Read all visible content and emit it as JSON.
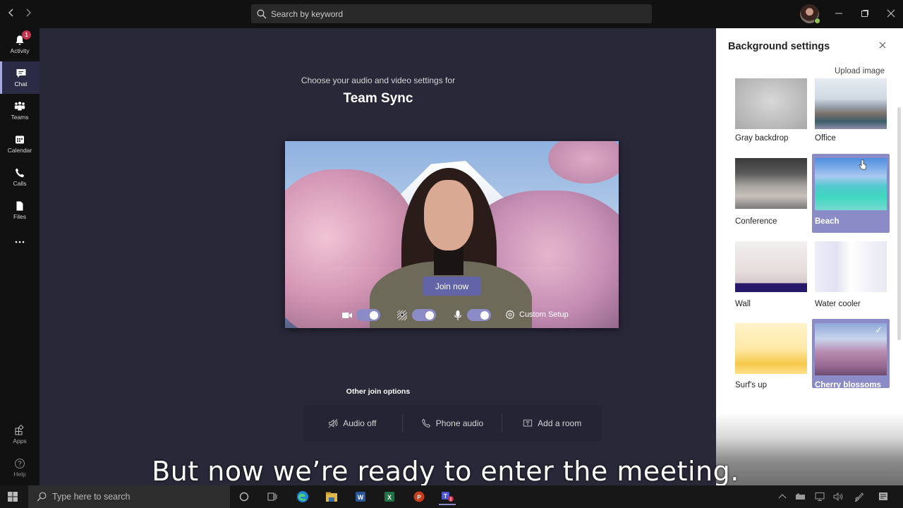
{
  "titlebar": {
    "back_icon": "chevron-left-icon",
    "forward_icon": "chevron-right-icon",
    "search_placeholder": "Search by keyword",
    "window_controls": [
      "minimize",
      "maximize",
      "close"
    ],
    "user_presence": "available",
    "presence_color": "#92c353"
  },
  "rail": {
    "items": [
      {
        "label": "Activity",
        "icon": "bell-icon",
        "badge": "1",
        "active": false
      },
      {
        "label": "Chat",
        "icon": "chat-icon",
        "active": true
      },
      {
        "label": "Teams",
        "icon": "teams-icon",
        "active": false
      },
      {
        "label": "Calendar",
        "icon": "calendar-icon",
        "active": false
      },
      {
        "label": "Calls",
        "icon": "phone-icon",
        "active": false
      },
      {
        "label": "Files",
        "icon": "file-icon",
        "active": false
      },
      {
        "label": "",
        "icon": "more-icon",
        "active": false
      }
    ],
    "bottom_items": [
      {
        "label": "Apps",
        "icon": "apps-icon"
      },
      {
        "label": "Help",
        "icon": "help-icon"
      }
    ],
    "badge_color": "#c4314b",
    "active_color": "#a6a7dc"
  },
  "prejoin": {
    "prompt": "Choose your audio and video settings for",
    "meeting_title": "Team Sync",
    "join_label": "Join now",
    "video_on": true,
    "blur_on": true,
    "mic_on": true,
    "custom_setup_label": "Custom Setup",
    "other_join_title": "Other join options",
    "other_options": [
      {
        "label": "Audio off",
        "icon": "speaker-off-icon"
      },
      {
        "label": "Phone audio",
        "icon": "phone-icon"
      },
      {
        "label": "Add a room",
        "icon": "room-display-icon"
      }
    ],
    "accent_color": "#6264a7",
    "toggle_color": "#8b8cc7"
  },
  "background_panel": {
    "title": "Background settings",
    "upload_label": "Upload image",
    "tiles": [
      {
        "label": "Gray backdrop",
        "selected": false,
        "applied": false
      },
      {
        "label": "Office",
        "selected": false,
        "applied": false
      },
      {
        "label": "Conference",
        "selected": false,
        "applied": false
      },
      {
        "label": "Beach",
        "selected": true,
        "applied": false
      },
      {
        "label": "Wall",
        "selected": false,
        "applied": false
      },
      {
        "label": "Water cooler",
        "selected": false,
        "applied": false
      },
      {
        "label": "Surf's up",
        "selected": false,
        "applied": false
      },
      {
        "label": "Cherry blossoms",
        "selected": true,
        "applied": true
      }
    ],
    "selected_color": "#8b8cc7"
  },
  "caption": "But now we’re ready to enter the meeting.",
  "taskbar": {
    "search_placeholder": "Type here to search",
    "apps": [
      "cortana",
      "task-view",
      "edge",
      "file-explorer",
      "word",
      "excel",
      "powerpoint",
      "teams"
    ],
    "teams_badge": "1"
  }
}
